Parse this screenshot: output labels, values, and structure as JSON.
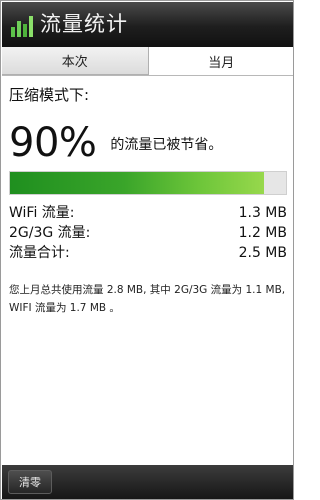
{
  "app": {
    "title": "流量统计",
    "icon": "bar-chart-icon",
    "accent_color": "#3aa52a"
  },
  "tabs": [
    {
      "label": "本次",
      "selected": false
    },
    {
      "label": "当月",
      "selected": true
    }
  ],
  "main": {
    "heading": "压缩模式下:",
    "percent_text": "90%",
    "saved_text": "的流量已被节省。",
    "progress_fraction": 0.92,
    "stats": [
      {
        "label": "WiFi 流量:",
        "value": "1.3 MB"
      },
      {
        "label": "2G/3G 流量:",
        "value": "1.2 MB"
      },
      {
        "label": "流量合计:",
        "value": "2.5 MB"
      }
    ],
    "note": "您上月总共使用流量 2.8 MB, 其中 2G/3G 流量为 1.1 MB, WIFI 流量为 1.7 MB 。"
  },
  "bottombar": {
    "reset_label": "清零"
  }
}
